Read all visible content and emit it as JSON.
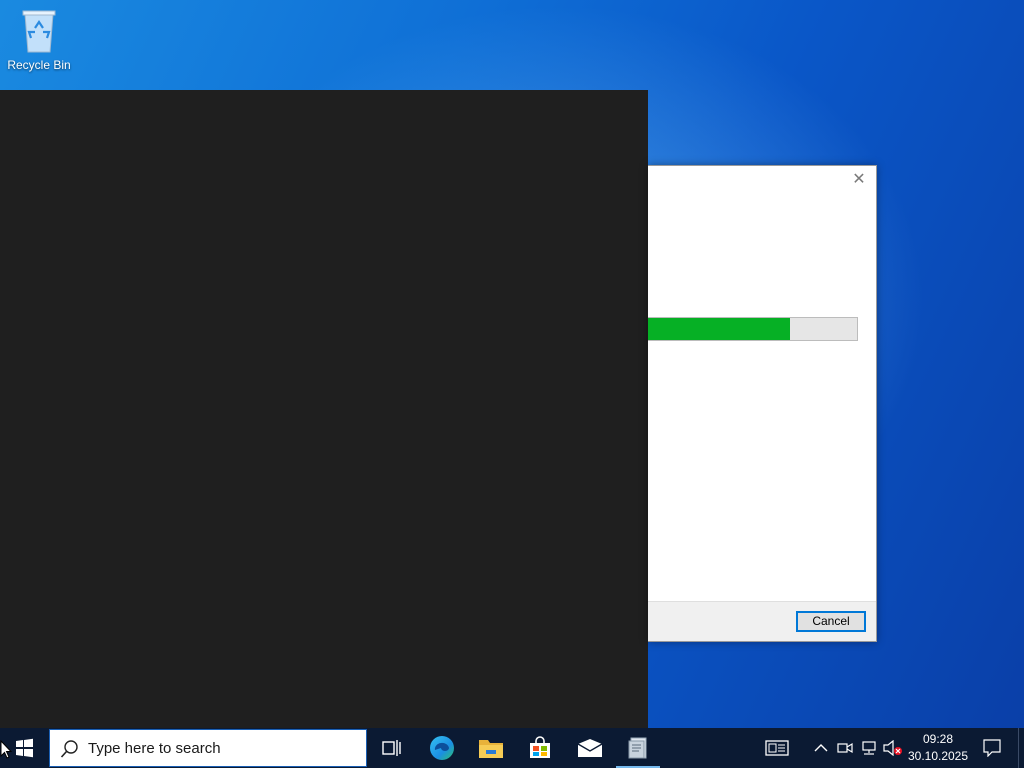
{
  "desktop": {
    "icons": [
      {
        "label": "Recycle Bin",
        "icon": "recycle-bin-icon"
      }
    ]
  },
  "dialog": {
    "close_icon": "close-icon",
    "progress_percent": 68,
    "progress_color": "#06b025",
    "cancel_label": "Cancel"
  },
  "taskbar": {
    "search_placeholder": "Type here to search",
    "pinned": [
      {
        "name": "task-view",
        "icon": "task-view-icon"
      },
      {
        "name": "microsoft-edge",
        "icon": "edge-icon"
      },
      {
        "name": "file-explorer",
        "icon": "folder-icon"
      },
      {
        "name": "microsoft-store",
        "icon": "store-icon"
      },
      {
        "name": "mail",
        "icon": "mail-icon"
      },
      {
        "name": "installer-app",
        "icon": "installer-icon",
        "active": true
      }
    ],
    "tray": {
      "icons": [
        "news-icon",
        "chevron-up-icon",
        "meet-icon",
        "network-icon",
        "volume-muted-icon",
        "notifications-icon"
      ]
    },
    "clock": {
      "time": "09:28",
      "date": "30.10.2025"
    }
  },
  "colors": {
    "accent": "#0078d7",
    "taskbar": "#0b1a33",
    "console_bg": "#1f1f1f"
  }
}
